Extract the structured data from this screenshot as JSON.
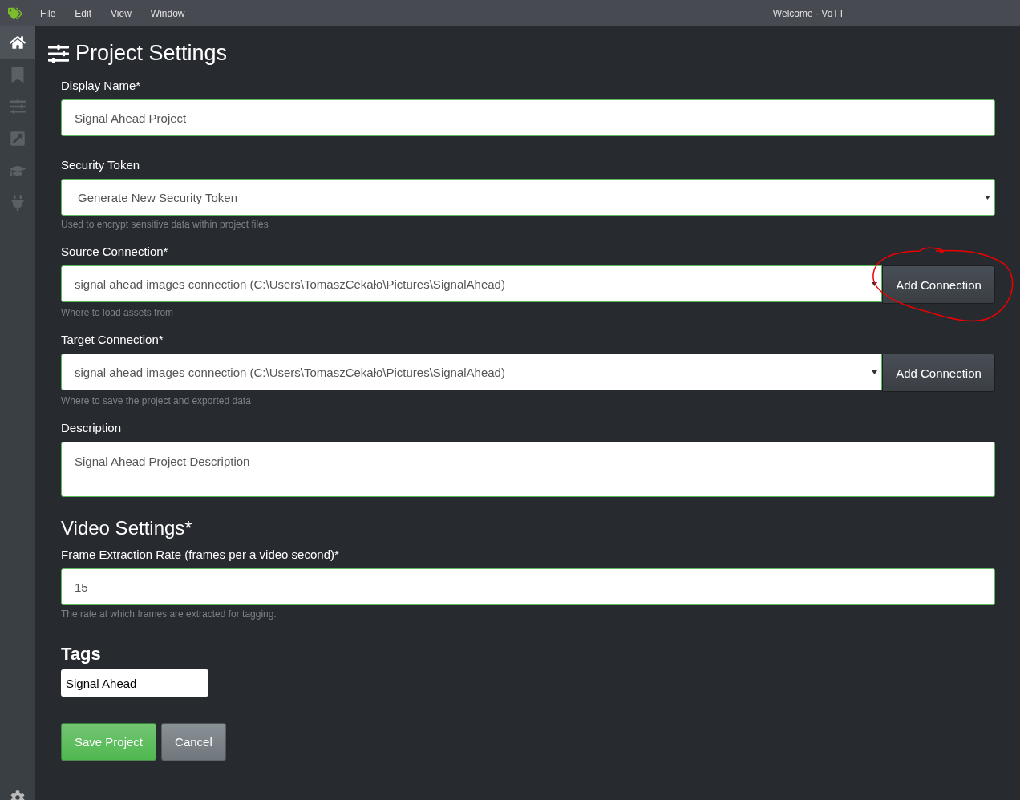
{
  "titlebar": {
    "menu": [
      "File",
      "Edit",
      "View",
      "Window"
    ],
    "title": "Welcome - VoTT"
  },
  "sidebar": {
    "items": [
      {
        "selected": true
      },
      {
        "selected": false
      },
      {
        "selected": false
      },
      {
        "selected": false
      },
      {
        "selected": false
      },
      {
        "selected": false
      }
    ]
  },
  "page_title": "Project Settings",
  "fields": [
    {
      "kind": "text",
      "label": "Display Name*",
      "value": "Signal Ahead Project"
    },
    {
      "kind": "select",
      "label": "Security Token",
      "value": "Generate New Security Token",
      "help": "Used to encrypt sensitive data within project files"
    },
    {
      "kind": "connection",
      "label": "Source Connection*",
      "value": "signal ahead images connection (C:\\Users\\TomaszCekało\\Pictures\\SignalAhead)",
      "button": "Add Connection",
      "help": "Where to load assets from",
      "circled": true
    },
    {
      "kind": "connection",
      "label": "Target Connection*",
      "value": "signal ahead images connection (C:\\Users\\TomaszCekało\\Pictures\\SignalAhead)",
      "button": "Add Connection",
      "help": "Where to save the project and exported data"
    },
    {
      "kind": "textarea",
      "label": "Description",
      "value": "Signal Ahead Project Description"
    },
    {
      "kind": "heading",
      "label": "Video Settings*"
    },
    {
      "kind": "text",
      "label": "Frame Extraction Rate (frames per a video second)*",
      "value": "15",
      "help": "The rate at which frames are extracted for tagging."
    }
  ],
  "tags": {
    "heading": "Tags",
    "value": "Signal Ahead"
  },
  "buttons": [
    {
      "kind": "primary",
      "label": "Save Project"
    },
    {
      "kind": "secondary",
      "label": "Cancel"
    }
  ]
}
